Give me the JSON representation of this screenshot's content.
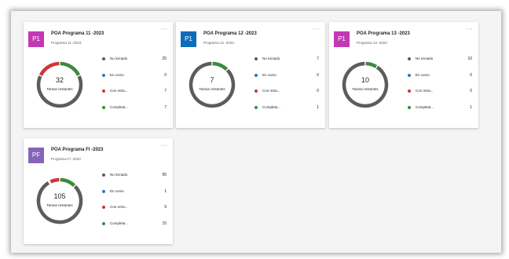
{
  "legend_labels": [
    "No iniciado",
    "En curso",
    "Con retra...",
    "Completa..."
  ],
  "status_colors": [
    "#5c5c5c",
    "#3277c0",
    "#d13438",
    "#3b8a3e"
  ],
  "remaining_label": "Tareas restantes",
  "more_icon": "···",
  "cards": [
    {
      "initials": "P1",
      "avatar_color": "#c239b3",
      "title": "POA Programa 11 -2023",
      "subtitle": "Programa 11 -2023",
      "remaining": "32",
      "counts": [
        "25",
        "0",
        "7",
        "7"
      ]
    },
    {
      "initials": "P1",
      "avatar_color": "#0f6cbd",
      "title": "POA Programa 12 -2023",
      "subtitle": "Programa 12 -2023",
      "remaining": "7",
      "counts": [
        "7",
        "0",
        "0",
        "1"
      ]
    },
    {
      "initials": "P1",
      "avatar_color": "#c239b3",
      "title": "POA Programa 13 -2023",
      "subtitle": "Programa 13 -2023",
      "remaining": "10",
      "counts": [
        "10",
        "0",
        "0",
        "1"
      ]
    },
    {
      "initials": "PF",
      "avatar_color": "#8764b8",
      "title": "POA Programa FI -2023",
      "subtitle": "Programa FI -2023",
      "remaining": "105",
      "counts": [
        "95",
        "1",
        "9",
        "15"
      ]
    }
  ]
}
